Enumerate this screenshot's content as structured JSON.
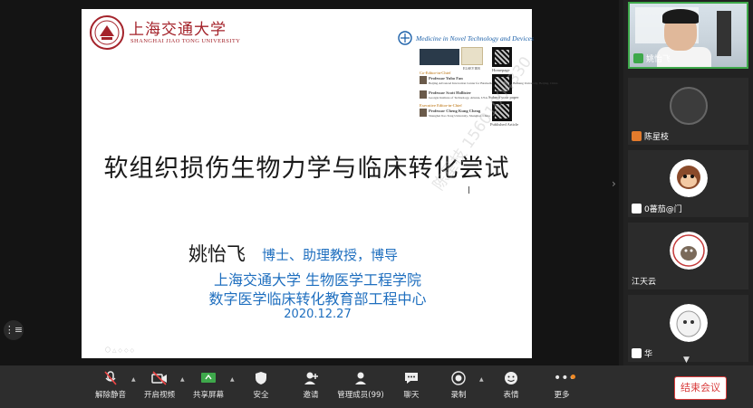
{
  "slide": {
    "university_cn": "上海交通大学",
    "university_en": "SHANGHAI JIAO TONG UNIVERSITY",
    "journal_title": "Medicine in Novel Technology and Devices",
    "editor_role_1": "Co-Editor-in-Chief",
    "editor_1": "Professor Yubo Fan",
    "editor_1_aff": "Beijing Advanced Innovation Center for Biomedical Engineering, Beihang University, Beijing, China",
    "editor_2": "Professor Scott Hollister",
    "editor_2_aff": "Georgia Institute of Technology, Atlanta, USA",
    "editor_role_2": "Executive Editor-in-Chief",
    "editor_3": "Professor Cheng Kung Cheng",
    "editor_3_aff": "Shanghai Jiao Tong University, Shanghai, China",
    "qr_label_1": "Homepage",
    "qr_label_2": "Submit your paper",
    "qr_label_3": "Published Article",
    "publisher": "ELSEVIER",
    "title": "软组织损伤生物力学与临床转化尝试",
    "author_name": "姚怡飞",
    "author_title": "博士、助理教授，博导",
    "affiliation_1": "上海交通大学 生物医学工程学院",
    "affiliation_2": "数字医学临床转化教育部工程中心",
    "date": "2020.12.27",
    "watermark": "陈星枝 15601004330"
  },
  "participants": [
    {
      "name": "姚怡飞",
      "type": "video",
      "active": true,
      "icon": "mic-on-icon"
    },
    {
      "name": "陈星枝",
      "type": "photo",
      "active": false,
      "icon": "user-avatar-icon"
    },
    {
      "name": "0蕃茄@门",
      "type": "avatar",
      "active": false,
      "icon": "mic-off-icon"
    },
    {
      "name": "江天云",
      "type": "avatar",
      "active": false,
      "icon": ""
    },
    {
      "name": "华",
      "type": "avatar",
      "active": false,
      "icon": "mic-off-icon"
    }
  ],
  "toolbar": {
    "unmute": "解除静音",
    "start_video": "开启视频",
    "share_screen": "共享屏幕",
    "security": "安全",
    "invite": "邀请",
    "manage_members": "管理成员(99)",
    "chat": "聊天",
    "record": "录制",
    "reactions": "表情",
    "more": "更多",
    "end_meeting": "结束会议"
  },
  "colors": {
    "accent_red": "#d93b3b",
    "slide_blue": "#1f6fbf",
    "sjtu_red": "#a4232b",
    "active_green": "#3ea84b"
  }
}
